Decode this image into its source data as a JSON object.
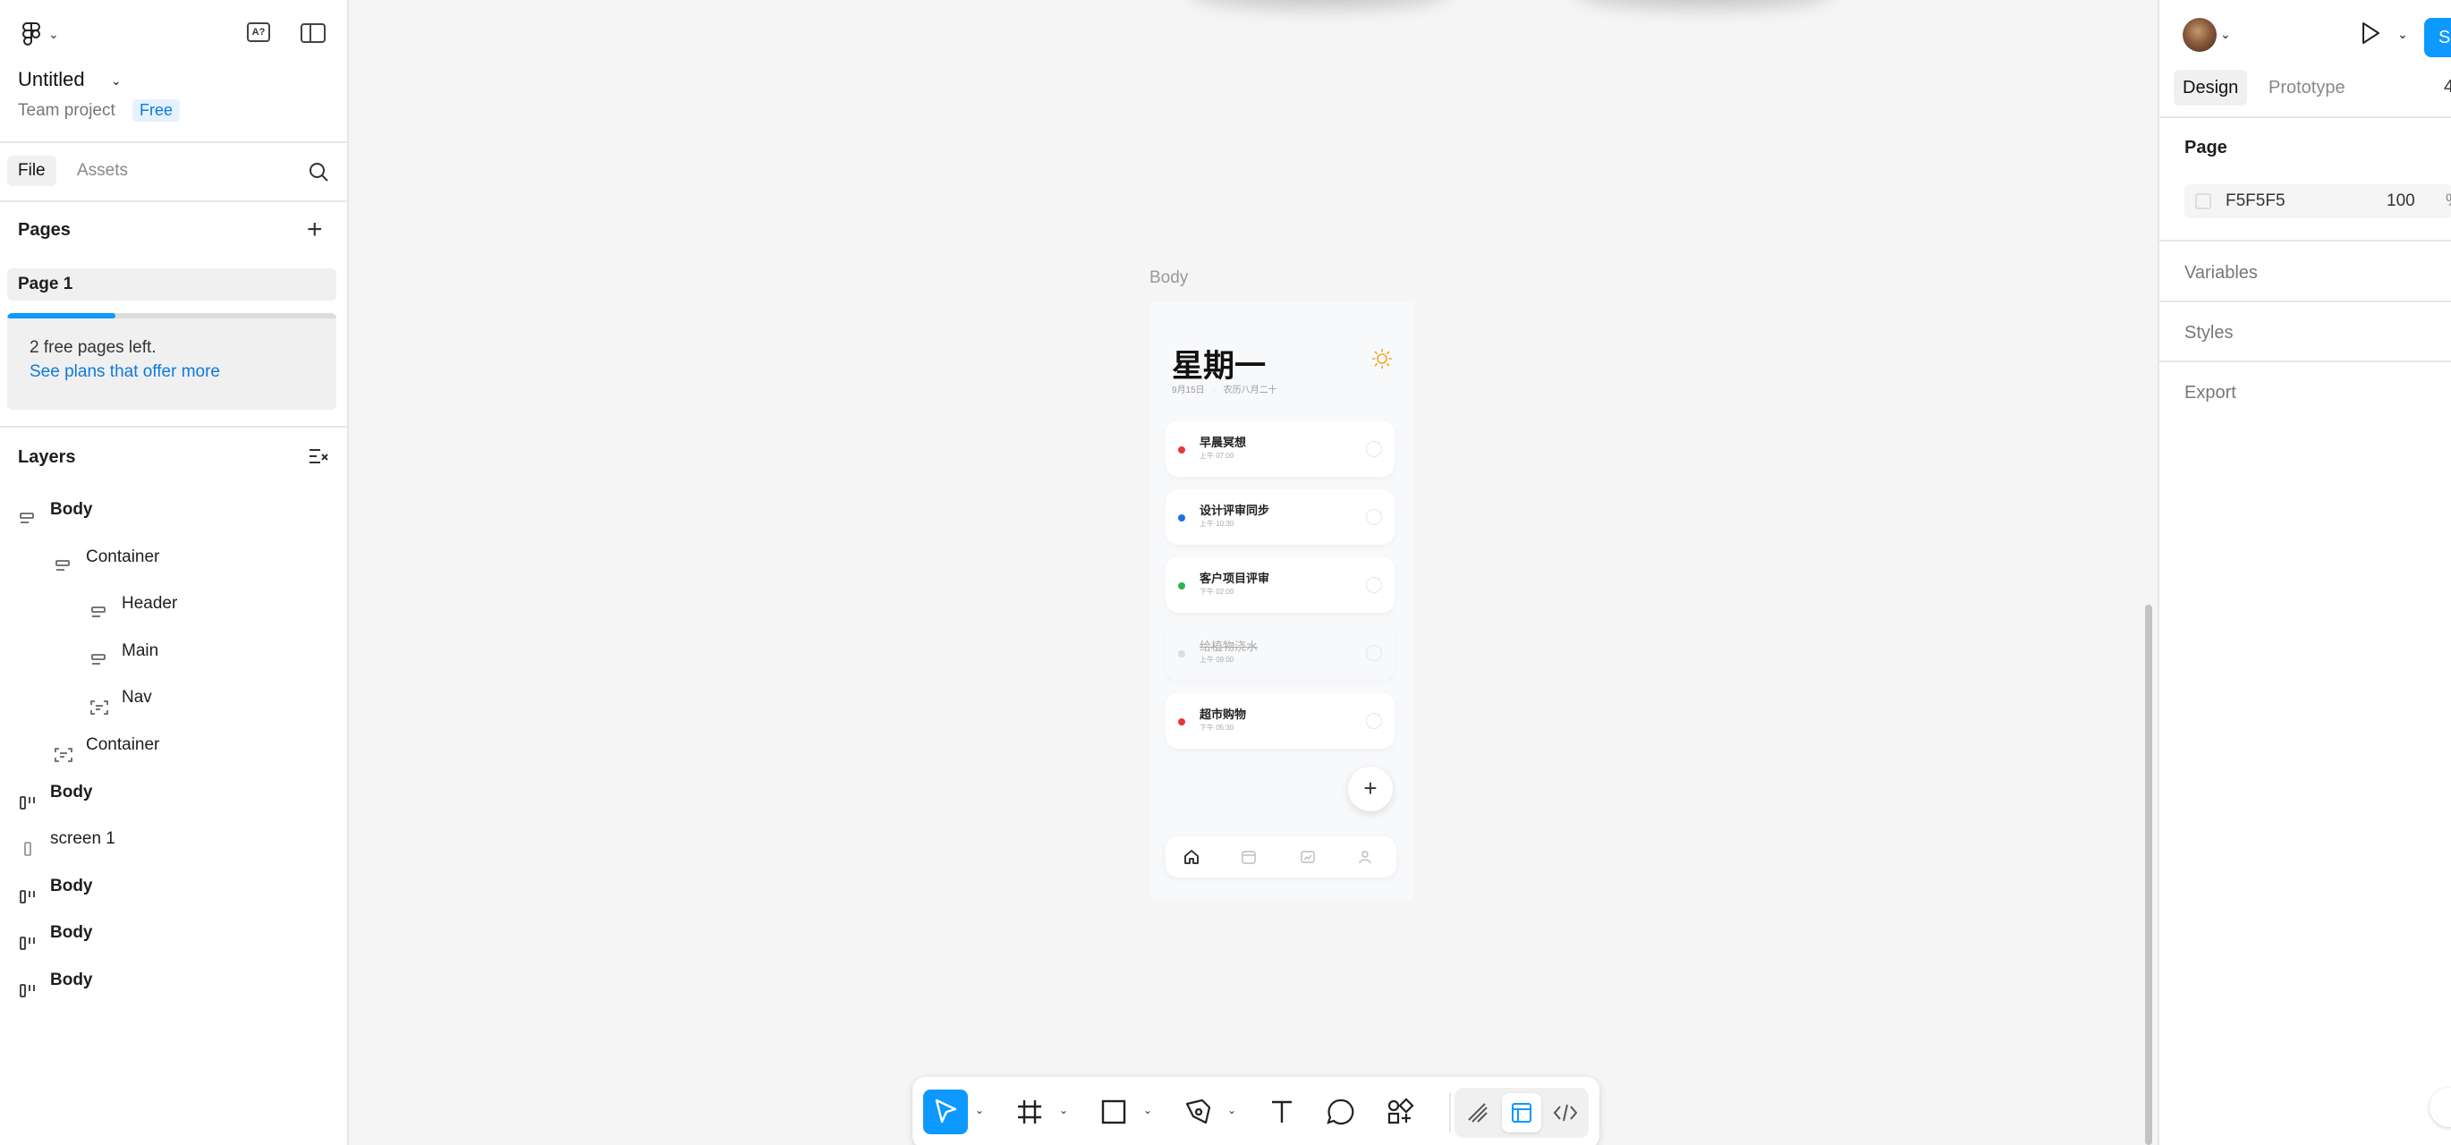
{
  "file": {
    "title": "Untitled",
    "team": "Team project",
    "plan_badge": "Free"
  },
  "left_tabs": {
    "file": "File",
    "assets": "Assets"
  },
  "pages": {
    "title": "Pages",
    "items": [
      "Page 1"
    ],
    "upsell_text": "2 free pages left.",
    "upsell_link": "See plans that offer more",
    "used_fraction": 0.33
  },
  "layers": {
    "title": "Layers",
    "items": [
      {
        "label": "Body",
        "icon": "auto-layout-vertical-icon",
        "bold": true
      },
      {
        "label": "Container",
        "icon": "auto-layout-vertical-icon",
        "bold": false
      },
      {
        "label": "Header",
        "icon": "auto-layout-vertical-icon",
        "bold": false
      },
      {
        "label": "Main",
        "icon": "auto-layout-vertical-icon",
        "bold": false
      },
      {
        "label": "Nav",
        "icon": "frame-dashed-icon",
        "bold": false
      },
      {
        "label": "Container",
        "icon": "frame-dashed-icon",
        "bold": false
      },
      {
        "label": "Body",
        "icon": "auto-layout-horizontal-icon",
        "bold": true
      },
      {
        "label": "screen 1",
        "icon": "rectangle-icon",
        "bold": false
      },
      {
        "label": "Body",
        "icon": "auto-layout-horizontal-icon",
        "bold": true
      },
      {
        "label": "Body",
        "icon": "auto-layout-horizontal-icon",
        "bold": true
      },
      {
        "label": "Body",
        "icon": "auto-layout-horizontal-icon",
        "bold": true
      }
    ]
  },
  "right": {
    "share_label": "S",
    "tabs": {
      "design": "Design",
      "prototype": "Prototype"
    },
    "zoom": "4",
    "page_section": "Page",
    "page_fill": {
      "hex": "F5F5F5",
      "opacity": "100",
      "unit": "%"
    },
    "sections": [
      "Variables",
      "Styles",
      "Export"
    ]
  },
  "canvas": {
    "frame_label": "Body",
    "app": {
      "day": "星期一",
      "date": "9月15日",
      "lunar": "农历八月二十",
      "tasks": [
        {
          "title": "早晨冥想",
          "time": "上午 07:00",
          "color": "#e53935",
          "done": false
        },
        {
          "title": "设计评审同步",
          "time": "上午 10:30",
          "color": "#1e6fe6",
          "done": false
        },
        {
          "title": "客户项目评审",
          "time": "下午 02:00",
          "color": "#2db34a",
          "done": false
        },
        {
          "title": "给植物浇水",
          "time": "上午 09:00",
          "color": "#dddddd",
          "done": true
        },
        {
          "title": "超市购物",
          "time": "下午 05:30",
          "color": "#e53935",
          "done": false
        }
      ],
      "fab": "+"
    }
  },
  "colors": {
    "accent": "#0d99ff",
    "canvas_bg": "#f5f5f5",
    "sun": "#f5a623"
  }
}
